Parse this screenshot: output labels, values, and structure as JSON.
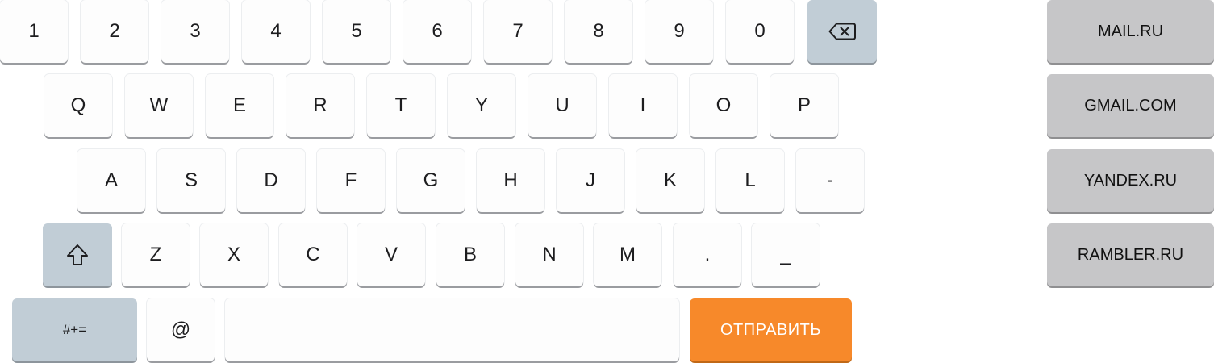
{
  "keyboard": {
    "digits": [
      "1",
      "2",
      "3",
      "4",
      "5",
      "6",
      "7",
      "8",
      "9",
      "0"
    ],
    "row_qwerty": [
      "Q",
      "W",
      "E",
      "R",
      "T",
      "Y",
      "U",
      "I",
      "O",
      "P"
    ],
    "row_asdf": [
      "A",
      "S",
      "D",
      "F",
      "G",
      "H",
      "J",
      "K",
      "L",
      "-"
    ],
    "row_zxcv": [
      "Z",
      "X",
      "C",
      "V",
      "B",
      "N",
      "M",
      ".",
      "_"
    ],
    "symbols_label": "#+=",
    "at_label": "@",
    "space_label": "",
    "send_label": "ОТПРАВИТЬ",
    "backspace_icon": "backspace-icon",
    "shift_icon": "shift-arrow-icon"
  },
  "domains": [
    "MAIL.RU",
    "GMAIL.COM",
    "YANDEX.RU",
    "RAMBLER.RU"
  ],
  "colors": {
    "key_bg": "#fdfdfd",
    "function_key_bg": "#c1cdd6",
    "domain_key_bg": "#c6c6c8",
    "send_bg": "#f7892a",
    "send_text": "#ffffff"
  }
}
